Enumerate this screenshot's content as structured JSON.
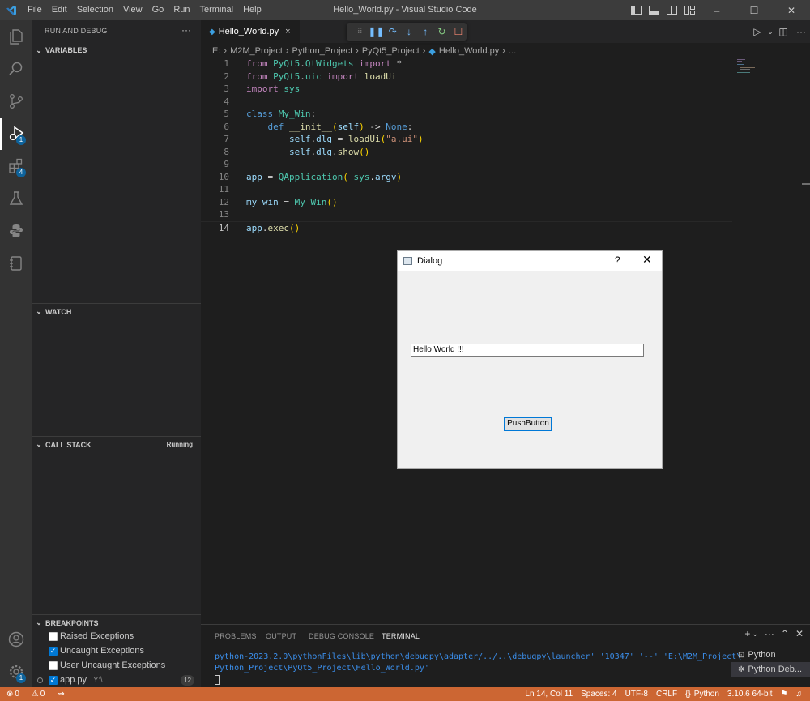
{
  "window": {
    "title": "Hello_World.py - Visual Studio Code",
    "menu": [
      "File",
      "Edit",
      "Selection",
      "View",
      "Go",
      "Run",
      "Terminal",
      "Help"
    ]
  },
  "activity_bar": {
    "items": [
      {
        "icon": "explorer-icon"
      },
      {
        "icon": "search-icon"
      },
      {
        "icon": "source-control-icon"
      },
      {
        "icon": "run-debug-icon",
        "badge": "1",
        "active": true
      },
      {
        "icon": "extensions-icon",
        "badge": "4"
      },
      {
        "icon": "testing-icon"
      },
      {
        "icon": "python-icon"
      },
      {
        "icon": "notebook-icon"
      }
    ],
    "bottom": [
      {
        "icon": "account-icon"
      },
      {
        "icon": "manage-gear-icon",
        "badge": "1"
      }
    ]
  },
  "sidebar": {
    "title": "RUN AND DEBUG",
    "more": "···",
    "sections": {
      "variables": "VARIABLES",
      "watch": "WATCH",
      "call_stack": "CALL STACK",
      "call_stack_status": "Running",
      "breakpoints": "BREAKPOINTS"
    },
    "breakpoints": [
      {
        "label": "Raised Exceptions",
        "checked": false
      },
      {
        "label": "Uncaught Exceptions",
        "checked": true
      },
      {
        "label": "User Uncaught Exceptions",
        "checked": false
      },
      {
        "label": "app.py",
        "path": "Y:\\",
        "count": "12",
        "checked": true
      }
    ]
  },
  "editor": {
    "tab": {
      "label": "Hello_World.py",
      "close": "×"
    },
    "breadcrumb": [
      "E:",
      "M2M_Project",
      "Python_Project",
      "PyQt5_Project",
      "Hello_World.py",
      "..."
    ],
    "line_numbers": [
      "1",
      "2",
      "3",
      "4",
      "5",
      "6",
      "7",
      "8",
      "9",
      "10",
      "11",
      "12",
      "13",
      "14"
    ],
    "current_line": "14"
  },
  "dialog": {
    "title": "Dialog",
    "help": "?",
    "close": "✕",
    "line_edit_value": "Hello World !!!",
    "button_label": "PushButton"
  },
  "panel": {
    "tabs": [
      "PROBLEMS",
      "OUTPUT",
      "DEBUG CONSOLE",
      "TERMINAL"
    ],
    "active_tab": "TERMINAL",
    "terminal_lines": [
      "python-2023.2.0\\pythonFiles\\lib\\python\\debugpy\\adapter/../..\\debugpy\\launcher' '10347' '--' 'E:\\M2M_Project\\",
      "Python_Project\\PyQt5_Project\\Hello_World.py'"
    ],
    "terminals": [
      {
        "label": "Python",
        "icon": "terminal-icon"
      },
      {
        "label": "Python Deb...",
        "icon": "debug-icon",
        "selected": true
      }
    ]
  },
  "statusbar": {
    "errors": "0",
    "warnings": "0",
    "position": "Ln 14, Col 11",
    "spaces": "Spaces: 4",
    "encoding": "UTF-8",
    "eol": "CRLF",
    "language": "Python",
    "interpreter": "3.10.6 64-bit"
  },
  "colors": {
    "statusbar": "#cc6633",
    "activity_bar": "#333333",
    "sidebar": "#252526",
    "editor": "#1e1e1e",
    "accent": "#0078d4"
  }
}
